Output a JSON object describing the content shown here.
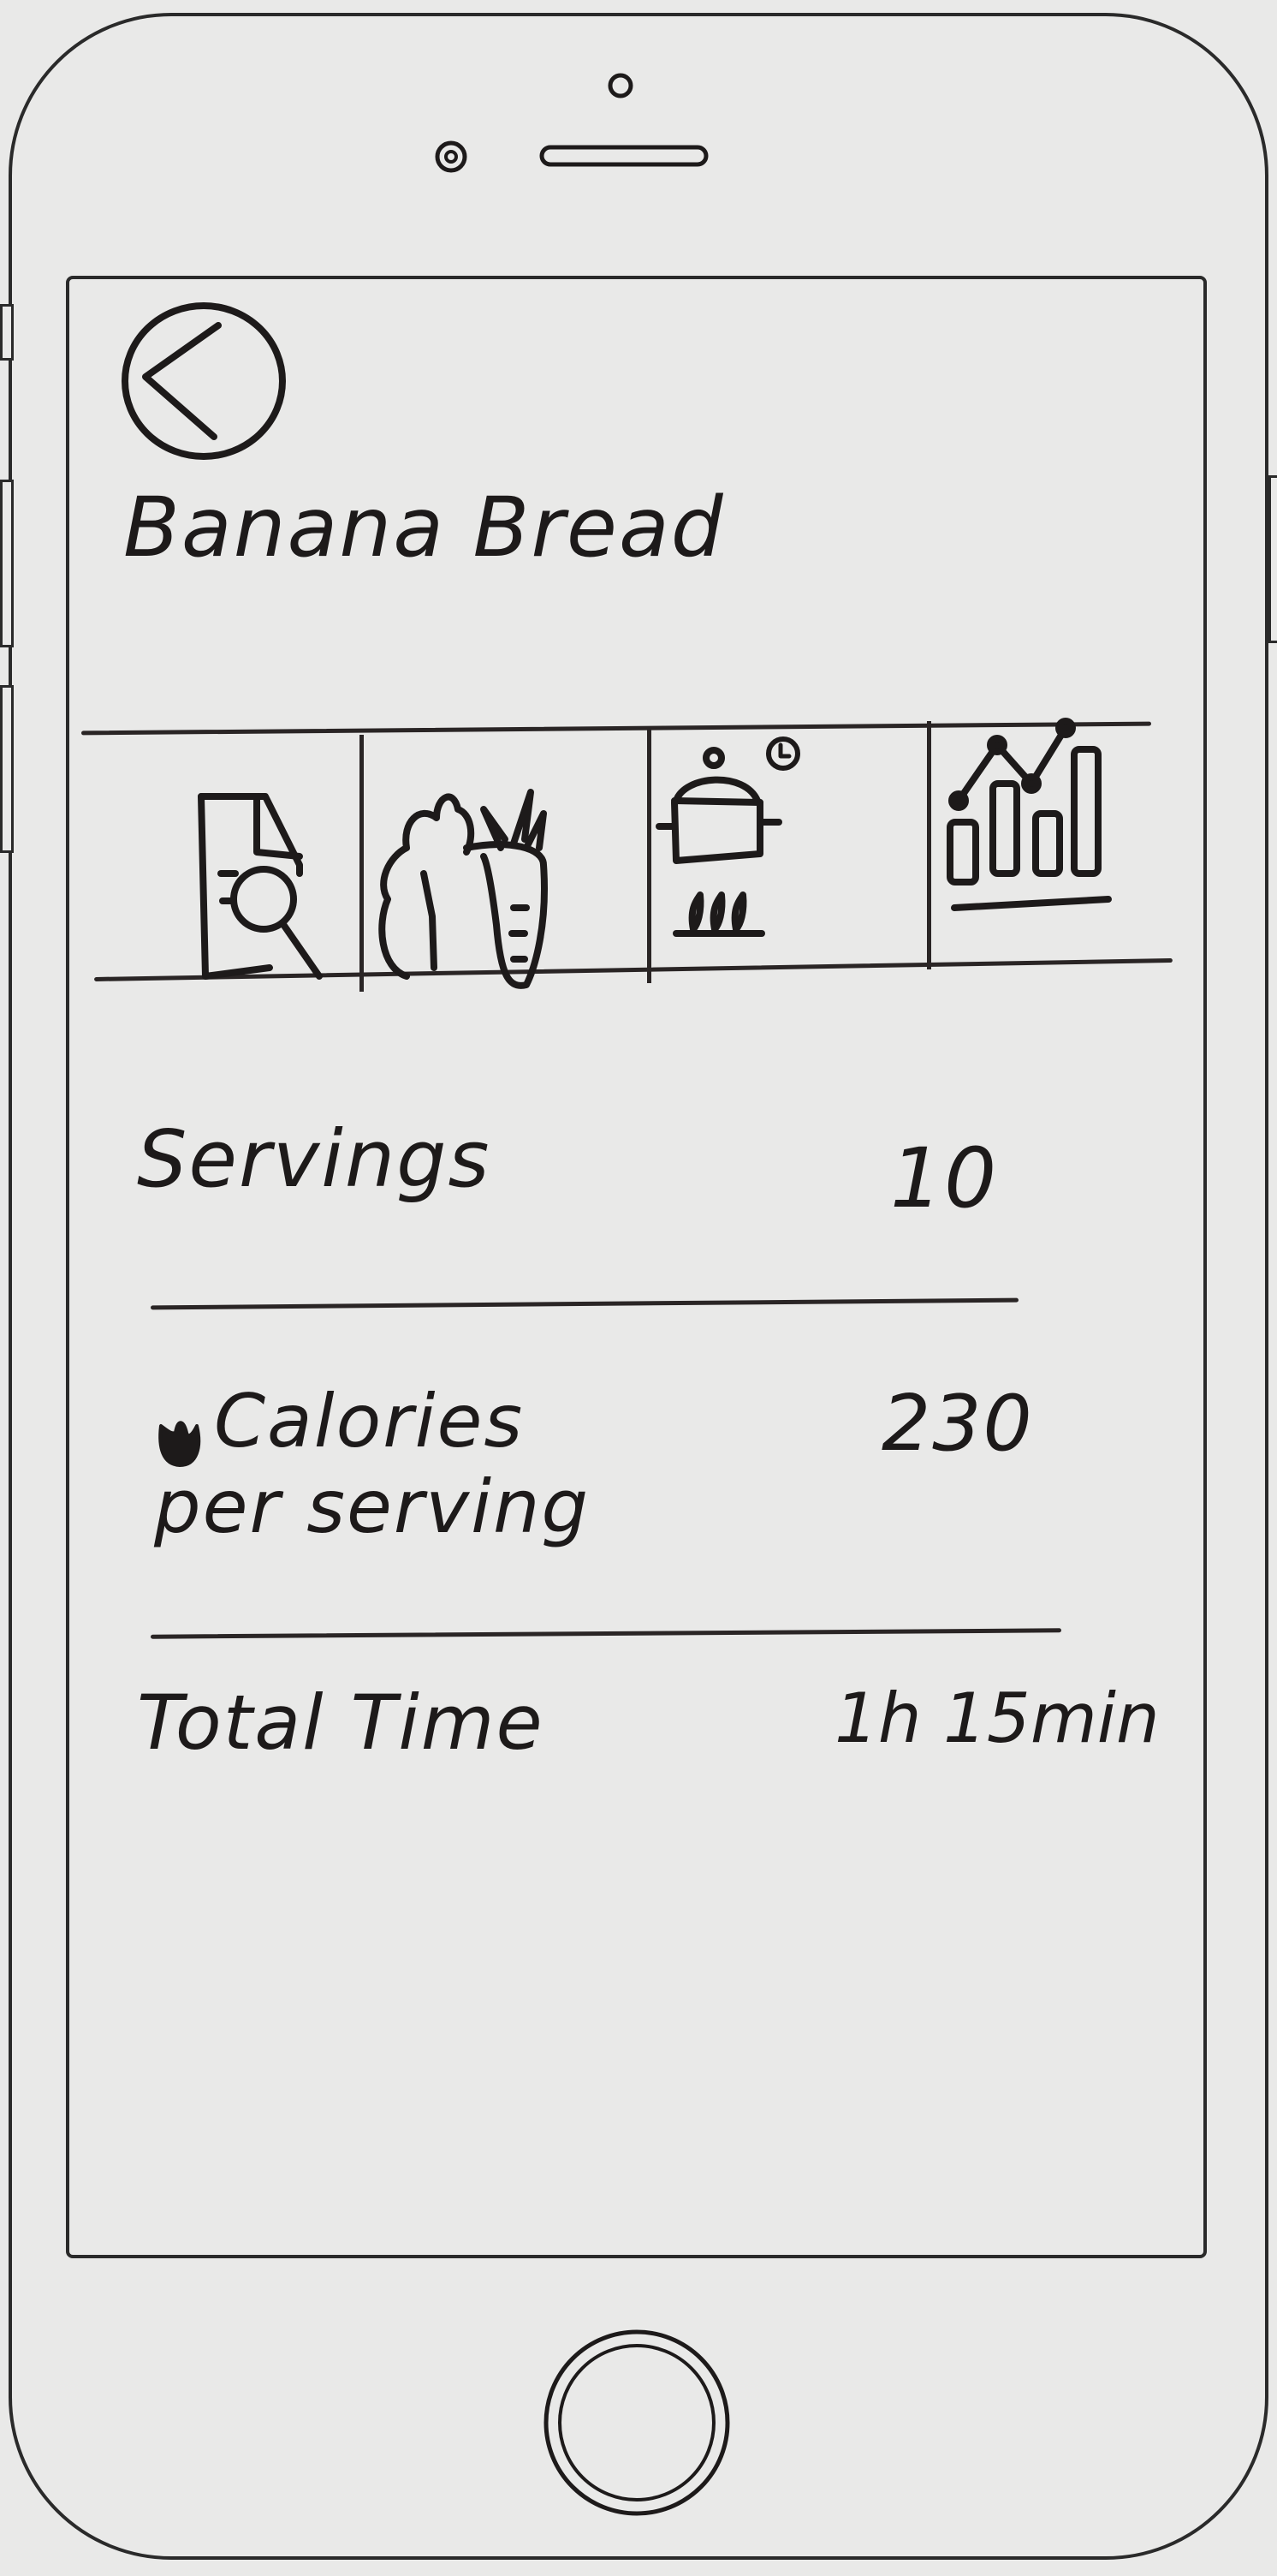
{
  "header": {
    "back_icon": "chevron-left-circle-icon",
    "title": "Banana Bread"
  },
  "tabs": [
    {
      "id": "recipe-details",
      "icon": "document-search-icon"
    },
    {
      "id": "ingredients",
      "icon": "vegetables-icon"
    },
    {
      "id": "cooking",
      "icon": "cooking-pot-timer-icon"
    },
    {
      "id": "nutrition",
      "icon": "bar-line-chart-icon"
    }
  ],
  "info": {
    "servings_label": "Servings",
    "servings_value": "10",
    "calories_label_line1": "Calories",
    "calories_label_line2": "per serving",
    "calories_value": "230",
    "calories_icon": "flame-icon",
    "total_time_label": "Total Time",
    "total_time_value": "1h 15min"
  }
}
